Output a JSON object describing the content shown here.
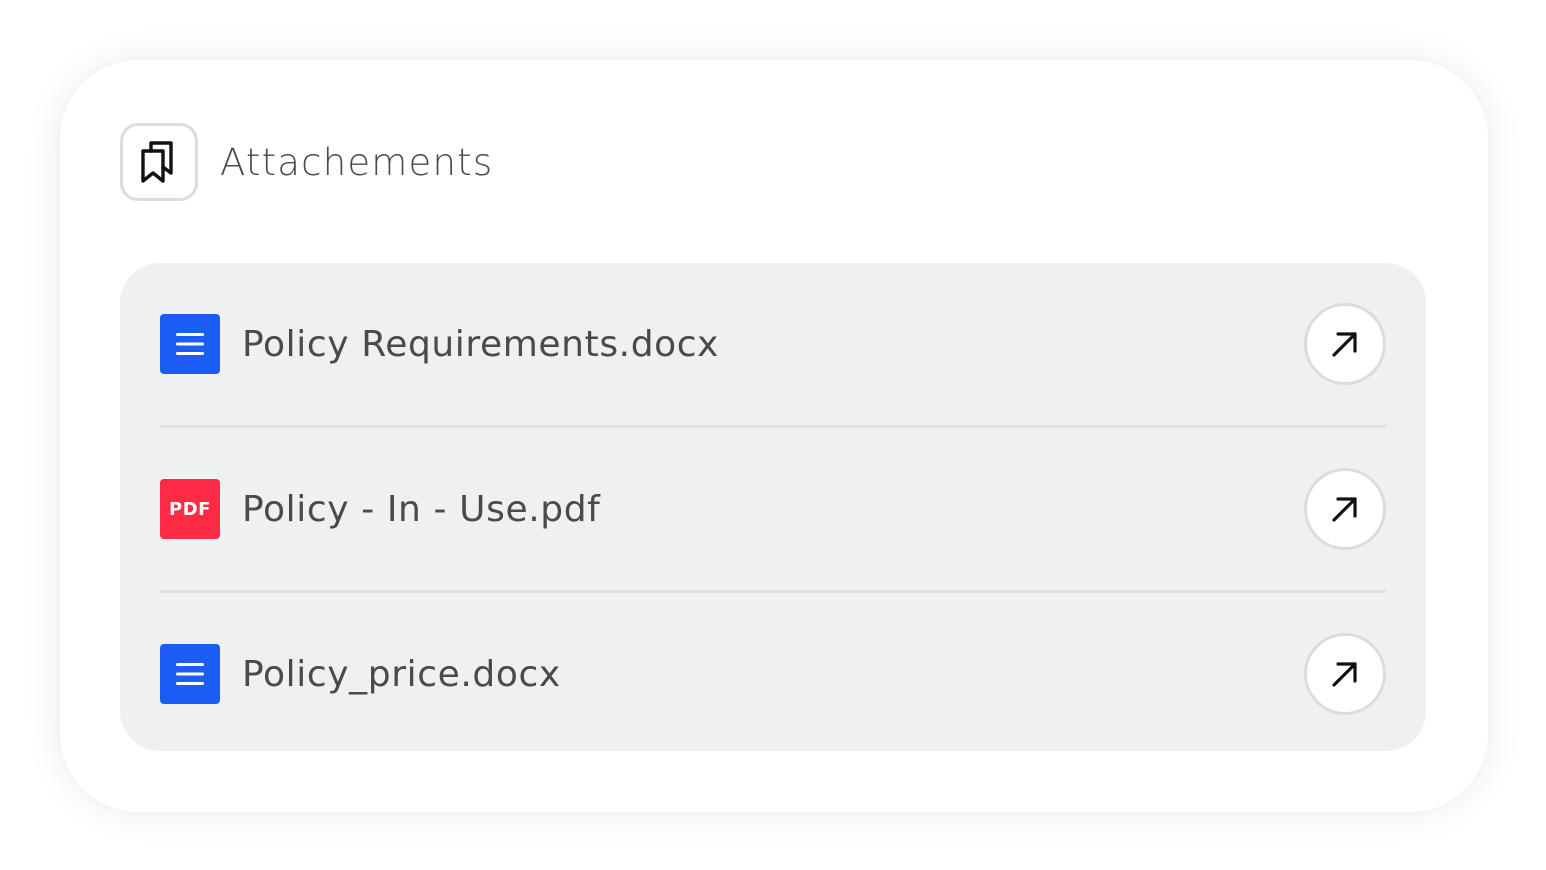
{
  "card": {
    "title": "Attachements",
    "header_icon": "bookmarks-icon"
  },
  "attachments": [
    {
      "name": "Policy Requirements.docx",
      "type": "doc",
      "icon": "document-icon",
      "color": "#1b5cf4"
    },
    {
      "name": "Policy - In - Use.pdf",
      "type": "pdf",
      "icon": "pdf-icon",
      "icon_label": "PDF",
      "color": "#ff2a44"
    },
    {
      "name": "Policy_price.docx",
      "type": "doc",
      "icon": "document-icon",
      "color": "#1b5cf4"
    }
  ],
  "action_icon": "arrow-up-right-icon"
}
